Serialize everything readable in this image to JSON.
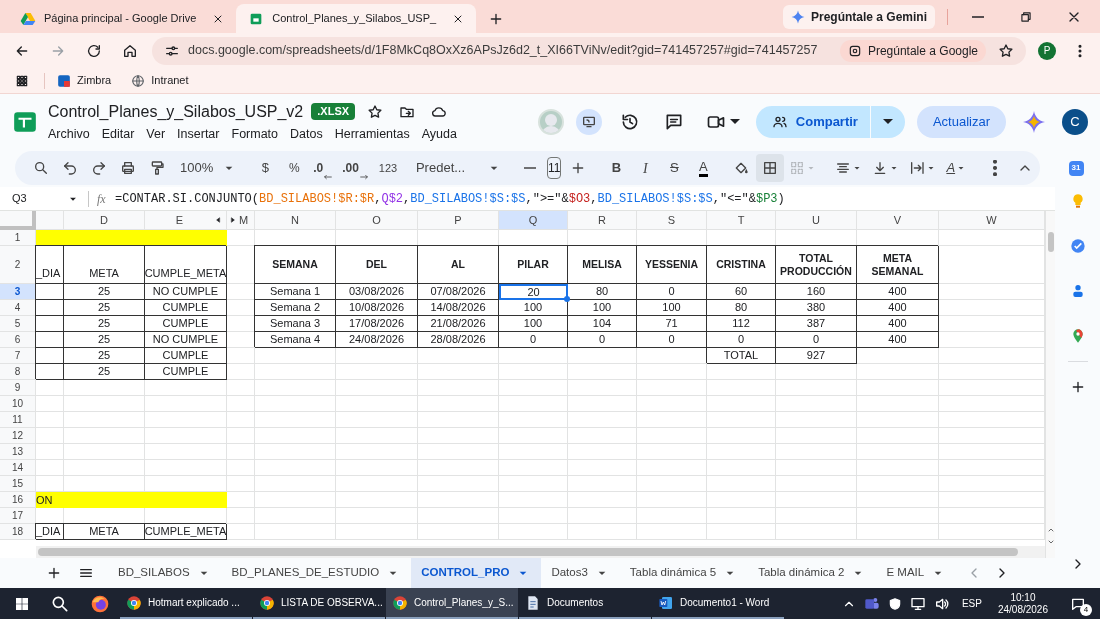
{
  "browser": {
    "tabs": [
      {
        "title": "Página principal - Google Drive",
        "selected": false,
        "kind": "drive"
      },
      {
        "title": "Control_Planes_y_Silabos_USP_",
        "selected": true,
        "kind": "sheets"
      }
    ],
    "gemini_button": "Pregúntale a Gemini",
    "url": "docs.google.com/spreadsheets/d/1F8MkCq8OxXz6APsJz6d2_t_XI66TViNv/edit?gid=741457257#gid=741457257",
    "ask_google": "Pregúntale a Google",
    "profile": "P",
    "bookmarks": [
      {
        "label": "Zimbra",
        "kind": "zimbra"
      },
      {
        "label": "Intranet",
        "kind": "intranet"
      }
    ]
  },
  "doc": {
    "title": "Control_Planes_y_Silabos_USP_v2",
    "badge": ".XLSX",
    "menu": [
      "Archivo",
      "Editar",
      "Ver",
      "Insertar",
      "Formato",
      "Datos",
      "Herramientas",
      "Ayuda"
    ],
    "share": "Compartir",
    "update": "Actualizar",
    "account": "C"
  },
  "toolbar": {
    "zoom": "100%",
    "currency": "$",
    "percent": "%",
    "decrease_decimals": ".0",
    "increase_decimals": ".00",
    "number_format": "123",
    "font": "Predet...",
    "font_size": "11",
    "bold": "B",
    "italic": "I",
    "strikethrough": "S",
    "text_color": "A",
    "rotation": "A"
  },
  "formula_bar": {
    "cell": "Q3",
    "fx": "fx",
    "formula": [
      {
        "text": "=CONTAR.SI.CONJUNTO("
      },
      {
        "text": "BD_SILABOS!$R:$R",
        "color": "#e8710a"
      },
      {
        "text": ","
      },
      {
        "text": "Q$2",
        "color": "#9334e6"
      },
      {
        "text": ","
      },
      {
        "text": "BD_SILABOS!$S:$S",
        "color": "#1a73e8"
      },
      {
        "text": ",\">=\"&"
      },
      {
        "text": "$O3",
        "color": "#c5221f"
      },
      {
        "text": ","
      },
      {
        "text": "BD_SILABOS!$S:$S",
        "color": "#1a73e8"
      },
      {
        "text": ",\"<=\"&"
      },
      {
        "text": "$P3",
        "color": "#188038"
      },
      {
        "text": ")"
      }
    ]
  },
  "columns": [
    {
      "label": "D",
      "selected": false
    },
    {
      "label": "E",
      "selected": false
    },
    {
      "label": "M",
      "selected": false
    },
    {
      "label": "N",
      "selected": false
    },
    {
      "label": "O",
      "selected": false
    },
    {
      "label": "P",
      "selected": false
    },
    {
      "label": "Q",
      "selected": true
    },
    {
      "label": "R",
      "selected": false
    },
    {
      "label": "S",
      "selected": false
    },
    {
      "label": "T",
      "selected": false
    },
    {
      "label": "U",
      "selected": false
    },
    {
      "label": "V",
      "selected": false
    },
    {
      "label": "W",
      "selected": false
    }
  ],
  "row_numbers": [
    {
      "label": "1",
      "selected": false
    },
    {
      "label": "2",
      "selected": false
    },
    {
      "label": "3",
      "selected": true
    },
    {
      "label": "4",
      "selected": false
    },
    {
      "label": "5",
      "selected": false
    },
    {
      "label": "6",
      "selected": false
    },
    {
      "label": "7",
      "selected": false
    },
    {
      "label": "8",
      "selected": false
    },
    {
      "label": "9",
      "selected": false
    },
    {
      "label": "10",
      "selected": false
    },
    {
      "label": "11",
      "selected": false
    },
    {
      "label": "12",
      "selected": false
    },
    {
      "label": "13",
      "selected": false
    },
    {
      "label": "14",
      "selected": false
    },
    {
      "label": "15",
      "selected": false
    },
    {
      "label": "16",
      "selected": false
    },
    {
      "label": "17",
      "selected": false
    },
    {
      "label": "18",
      "selected": false
    }
  ],
  "left_block": {
    "headers": [
      "_DIA",
      "META",
      "CUMPLE_META"
    ],
    "rows": [
      {
        "meta": "25",
        "cumple": "NO CUMPLE"
      },
      {
        "meta": "25",
        "cumple": "CUMPLE"
      },
      {
        "meta": "25",
        "cumple": "CUMPLE"
      },
      {
        "meta": "25",
        "cumple": "NO CUMPLE"
      },
      {
        "meta": "25",
        "cumple": "CUMPLE"
      },
      {
        "meta": "25",
        "cumple": "CUMPLE"
      }
    ],
    "band_text": "ON",
    "headers_2": [
      "_DIA",
      "META",
      "CUMPLE_META"
    ]
  },
  "weekly_table": {
    "headers": [
      "SEMANA",
      "DEL",
      "AL",
      "PILAR",
      "MELISA",
      "YESSENIA",
      "CRISTINA",
      "TOTAL PRODUCCIÓN",
      "META SEMANAL"
    ],
    "rows": [
      [
        {
          "text": "Semana 1",
          "selected": false
        },
        {
          "text": "03/08/2026",
          "selected": false
        },
        {
          "text": "07/08/2026",
          "selected": false
        },
        {
          "text": "20",
          "selected": true
        },
        {
          "text": "80",
          "selected": false
        },
        {
          "text": "0",
          "selected": false
        },
        {
          "text": "60",
          "selected": false
        },
        {
          "text": "160",
          "selected": false
        },
        {
          "text": "400",
          "selected": false
        }
      ],
      [
        {
          "text": "Semana 2",
          "selected": false
        },
        {
          "text": "10/08/2026",
          "selected": false
        },
        {
          "text": "14/08/2026",
          "selected": false
        },
        {
          "text": "100",
          "selected": false
        },
        {
          "text": "100",
          "selected": false
        },
        {
          "text": "100",
          "selected": false
        },
        {
          "text": "80",
          "selected": false
        },
        {
          "text": "380",
          "selected": false
        },
        {
          "text": "400",
          "selected": false
        }
      ],
      [
        {
          "text": "Semana 3",
          "selected": false
        },
        {
          "text": "17/08/2026",
          "selected": false
        },
        {
          "text": "21/08/2026",
          "selected": false
        },
        {
          "text": "100",
          "selected": false
        },
        {
          "text": "104",
          "selected": false
        },
        {
          "text": "71",
          "selected": false
        },
        {
          "text": "112",
          "selected": false
        },
        {
          "text": "387",
          "selected": false
        },
        {
          "text": "400",
          "selected": false
        }
      ],
      [
        {
          "text": "Semana 4",
          "selected": false
        },
        {
          "text": "24/08/2026",
          "selected": false
        },
        {
          "text": "28/08/2026",
          "selected": false
        },
        {
          "text": "0",
          "selected": false
        },
        {
          "text": "0",
          "selected": false
        },
        {
          "text": "0",
          "selected": false
        },
        {
          "text": "0",
          "selected": false
        },
        {
          "text": "0",
          "selected": false
        },
        {
          "text": "400",
          "selected": false
        }
      ]
    ],
    "total_label": "TOTAL",
    "total_value": "927"
  },
  "side_panel": {
    "calendar_day": "31"
  },
  "sheet_tabs": [
    {
      "label": "BD_SILABOS",
      "selected": false
    },
    {
      "label": "BD_PLANES_DE_ESTUDIO",
      "selected": false
    },
    {
      "label": "CONTROL_PRO",
      "selected": true
    },
    {
      "label": "Datos3",
      "selected": false
    },
    {
      "label": "Tabla dinámica 5",
      "selected": false
    },
    {
      "label": "Tabla dinámica 2",
      "selected": false
    },
    {
      "label": "E MAIL",
      "selected": false
    }
  ],
  "taskbar": {
    "apps": [
      {
        "label": "Hotmart explicado ...",
        "kind": "chrome",
        "selected": false
      },
      {
        "label": "LISTA DE OBSERVA...",
        "kind": "chrome",
        "selected": false
      },
      {
        "label": "Control_Planes_y_S...",
        "kind": "chrome",
        "selected": true
      },
      {
        "label": "Documentos",
        "kind": "folder",
        "selected": false
      },
      {
        "label": "Documento1 - Word",
        "kind": "word",
        "selected": false
      }
    ],
    "language": "ESP",
    "time": "10:10",
    "date": "24/08/2026",
    "notifications": "4"
  }
}
